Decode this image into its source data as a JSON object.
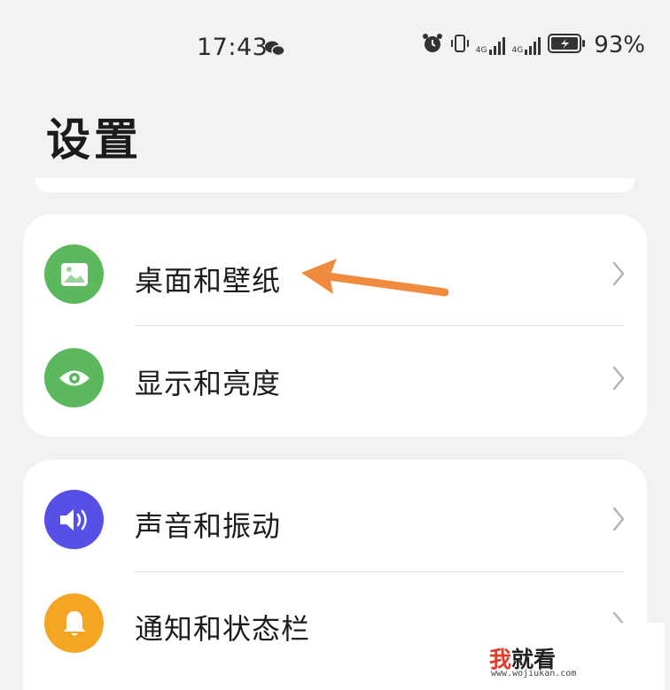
{
  "status_bar": {
    "time": "17:43",
    "signal_1": "4G",
    "signal_2": "4G",
    "battery": "93%"
  },
  "page": {
    "title": "设置"
  },
  "settings_groups": [
    {
      "items": [
        {
          "label": "桌面和壁纸",
          "icon": "image-icon",
          "color": "#5cb85c"
        },
        {
          "label": "显示和亮度",
          "icon": "eye-icon",
          "color": "#5cb85c"
        }
      ]
    },
    {
      "items": [
        {
          "label": "声音和振动",
          "icon": "speaker-icon",
          "color": "#5650e6"
        },
        {
          "label": "通知和状态栏",
          "icon": "bell-icon",
          "color": "#f5a524"
        }
      ]
    }
  ],
  "annotation": {
    "color": "#f08a3c"
  },
  "watermark": {
    "text_red": "我",
    "text_rest": "就看",
    "url": "www.wojiukan.com"
  }
}
